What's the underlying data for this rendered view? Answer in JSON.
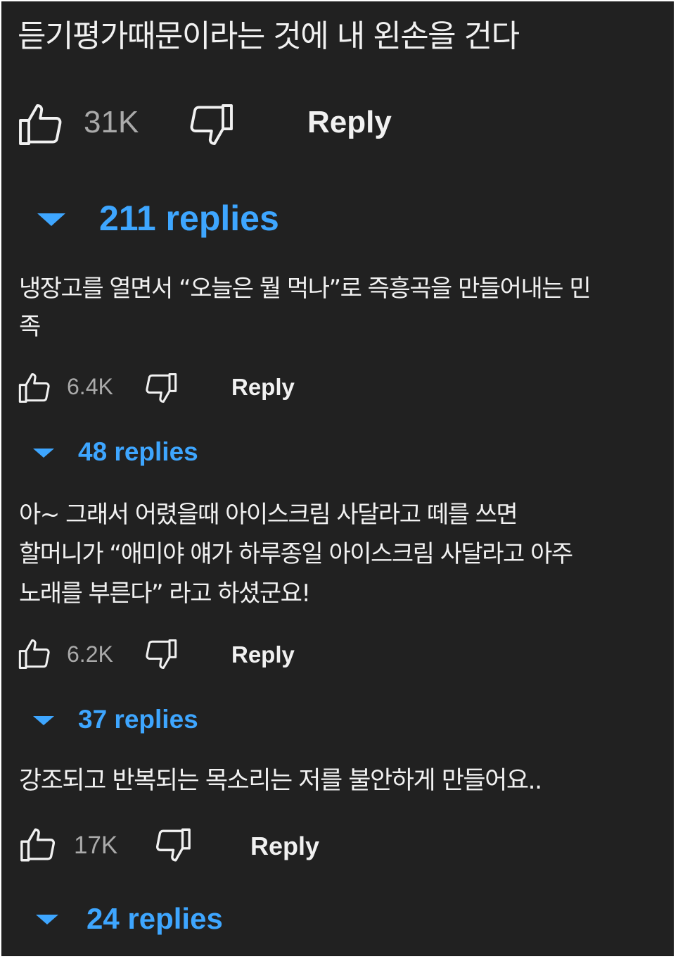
{
  "colors": {
    "background": "#212121",
    "text": "#f1f1f1",
    "muted": "#aaaaaa",
    "link": "#3ea6ff"
  },
  "icons": {
    "like": "thumbs-up-icon",
    "dislike": "thumbs-down-icon",
    "expand": "triangle-down-icon"
  },
  "comments": [
    {
      "text": "듣기평가때문이라는 것에 내 왼손을 건다",
      "likes": "31K",
      "reply_label": "Reply",
      "replies_label": "211 replies"
    },
    {
      "text": "냉장고를 열면서 “오늘은 뭘 먹나”로 즉흥곡을 만들어내는 민\n족",
      "likes": "6.4K",
      "reply_label": "Reply",
      "replies_label": "48 replies"
    },
    {
      "text": "아~ 그래서 어렸을때 아이스크림 사달라고 떼를 쓰면\n할머니가 “애미야 얘가 하루종일 아이스크림 사달라고 아주\n노래를 부른다” 라고 하셨군요!",
      "likes": "6.2K",
      "reply_label": "Reply",
      "replies_label": "37 replies"
    },
    {
      "text": "강조되고 반복되는 목소리는 저를 불안하게 만들어요..",
      "likes": "17K",
      "reply_label": "Reply",
      "replies_label": "24 replies"
    }
  ]
}
